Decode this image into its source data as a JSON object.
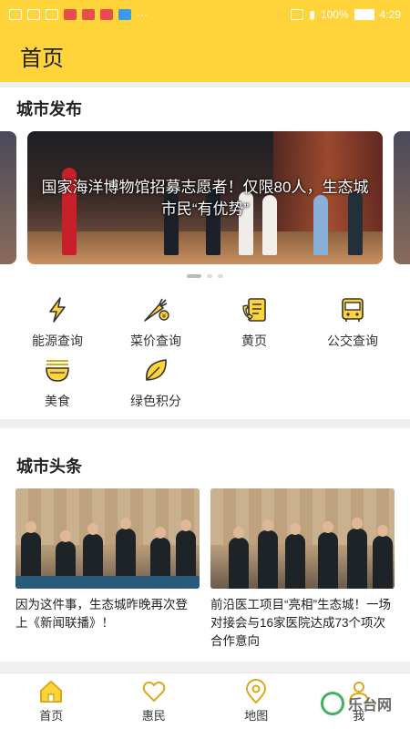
{
  "status_bar": {
    "battery": "100%",
    "time": "4:29"
  },
  "header": {
    "title": "首页"
  },
  "city_release": {
    "title": "城市发布",
    "carousel": {
      "caption": "国家海洋博物馆招募志愿者！仅限80人，生态城市民“有优势”",
      "active_index": 0,
      "count": 3
    }
  },
  "services": [
    {
      "label": "能源查询",
      "icon": "lightning-icon"
    },
    {
      "label": "菜价查询",
      "icon": "vegetable-price-icon"
    },
    {
      "label": "黄页",
      "icon": "yellow-pages-icon"
    },
    {
      "label": "公交查询",
      "icon": "bus-icon"
    },
    {
      "label": "美食",
      "icon": "food-bowl-icon"
    },
    {
      "label": "绿色积分",
      "icon": "leaf-icon"
    }
  ],
  "city_headlines": {
    "title": "城市头条",
    "items": [
      {
        "title": "因为这件事，生态城昨晚再次登上《新闻联播》！"
      },
      {
        "title": "前沿医工项目“亮相”生态城！一场对接会与16家医院达成73个项次合作意向"
      }
    ]
  },
  "tabbar": [
    {
      "label": "首页",
      "icon": "home-icon",
      "active": true
    },
    {
      "label": "惠民",
      "icon": "heart-icon",
      "active": false
    },
    {
      "label": "地图",
      "icon": "map-pin-icon",
      "active": false
    },
    {
      "label": "我",
      "icon": "person-icon",
      "active": false
    }
  ],
  "watermark": {
    "text": "乐台网"
  },
  "colors": {
    "accent": "#ffd33a",
    "icon": "#d9a91a"
  }
}
